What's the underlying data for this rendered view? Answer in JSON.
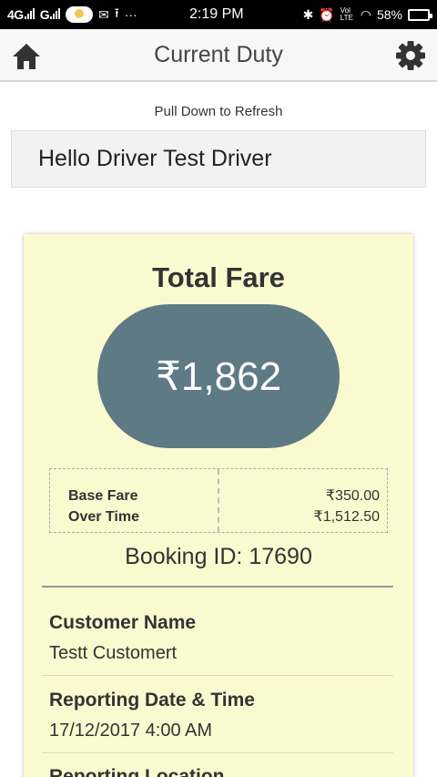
{
  "status_bar": {
    "network1": "4G",
    "network2": "G",
    "time": "2:19 PM",
    "volte": "Vol LTE",
    "battery": "58%"
  },
  "app_bar": {
    "title": "Current Duty",
    "home_icon": "home-icon",
    "settings_icon": "gear-icon"
  },
  "refresh_hint": "Pull Down to Refresh",
  "greeting": "Hello Driver Test Driver",
  "fare": {
    "title": "Total Fare",
    "total": "₹1,862",
    "breakdown": [
      {
        "label": "Base Fare",
        "value": "₹350.00"
      },
      {
        "label": "Over Time",
        "value": "₹1,512.50"
      }
    ]
  },
  "booking_id": "Booking ID: 17690",
  "details": [
    {
      "label": "Customer Name",
      "value": "Testt Customert"
    },
    {
      "label": "Reporting Date & Time",
      "value": "17/12/2017 4:00 AM"
    },
    {
      "label": "Reporting Location",
      "value": ""
    }
  ],
  "colors": {
    "card_background": "#fbf9cf",
    "fare_pill": "#5d7a85",
    "app_bar": "#f7f7f7"
  }
}
